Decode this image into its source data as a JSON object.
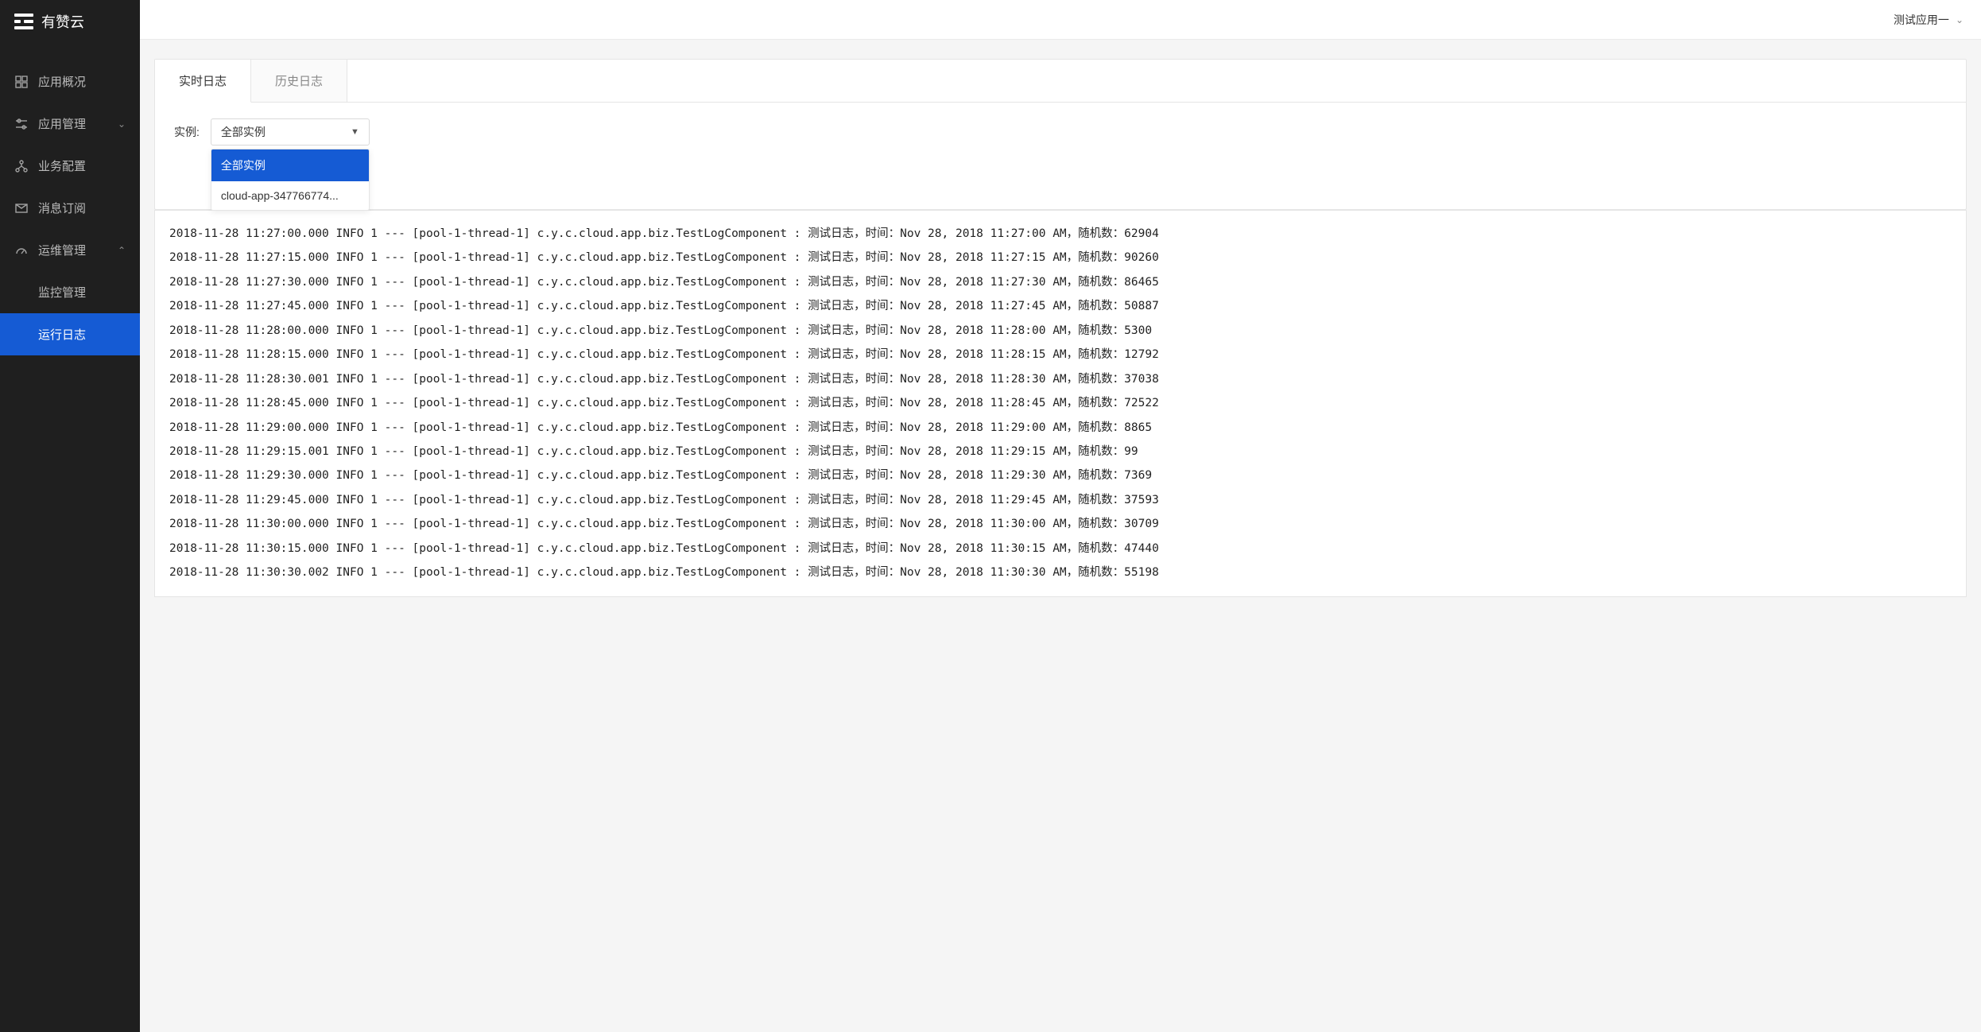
{
  "brand": "有赞云",
  "header": {
    "app_switcher_label": "测试应用一"
  },
  "sidebar": {
    "items": [
      {
        "label": "应用概况",
        "icon": "dashboard-icon"
      },
      {
        "label": "应用管理",
        "icon": "sliders-icon",
        "expandable": true,
        "expanded": false
      },
      {
        "label": "业务配置",
        "icon": "nodes-icon"
      },
      {
        "label": "消息订阅",
        "icon": "mail-icon"
      },
      {
        "label": "运维管理",
        "icon": "gauge-icon",
        "expandable": true,
        "expanded": true
      }
    ],
    "ops_sub": [
      {
        "label": "监控管理",
        "active": false
      },
      {
        "label": "运行日志",
        "active": true
      }
    ]
  },
  "tabs": [
    {
      "label": "实时日志",
      "active": true
    },
    {
      "label": "历史日志",
      "active": false
    }
  ],
  "filter": {
    "label": "实例:",
    "selected": "全部实例",
    "options": [
      "全部实例",
      "cloud-app-347766774..."
    ]
  },
  "logs": [
    "2018-11-28 11:27:00.000 INFO 1 --- [pool-1-thread-1] c.y.c.cloud.app.biz.TestLogComponent : 测试日志，时间：Nov 28, 2018 11:27:00 AM，随机数：62904",
    "2018-11-28 11:27:15.000 INFO 1 --- [pool-1-thread-1] c.y.c.cloud.app.biz.TestLogComponent : 测试日志，时间：Nov 28, 2018 11:27:15 AM，随机数：90260",
    "2018-11-28 11:27:30.000 INFO 1 --- [pool-1-thread-1] c.y.c.cloud.app.biz.TestLogComponent : 测试日志，时间：Nov 28, 2018 11:27:30 AM，随机数：86465",
    "2018-11-28 11:27:45.000 INFO 1 --- [pool-1-thread-1] c.y.c.cloud.app.biz.TestLogComponent : 测试日志，时间：Nov 28, 2018 11:27:45 AM，随机数：50887",
    "2018-11-28 11:28:00.000 INFO 1 --- [pool-1-thread-1] c.y.c.cloud.app.biz.TestLogComponent : 测试日志，时间：Nov 28, 2018 11:28:00 AM，随机数：5300",
    "2018-11-28 11:28:15.000 INFO 1 --- [pool-1-thread-1] c.y.c.cloud.app.biz.TestLogComponent : 测试日志，时间：Nov 28, 2018 11:28:15 AM，随机数：12792",
    "2018-11-28 11:28:30.001 INFO 1 --- [pool-1-thread-1] c.y.c.cloud.app.biz.TestLogComponent : 测试日志，时间：Nov 28, 2018 11:28:30 AM，随机数：37038",
    "2018-11-28 11:28:45.000 INFO 1 --- [pool-1-thread-1] c.y.c.cloud.app.biz.TestLogComponent : 测试日志，时间：Nov 28, 2018 11:28:45 AM，随机数：72522",
    "2018-11-28 11:29:00.000 INFO 1 --- [pool-1-thread-1] c.y.c.cloud.app.biz.TestLogComponent : 测试日志，时间：Nov 28, 2018 11:29:00 AM，随机数：8865",
    "2018-11-28 11:29:15.001 INFO 1 --- [pool-1-thread-1] c.y.c.cloud.app.biz.TestLogComponent : 测试日志，时间：Nov 28, 2018 11:29:15 AM，随机数：99",
    "2018-11-28 11:29:30.000 INFO 1 --- [pool-1-thread-1] c.y.c.cloud.app.biz.TestLogComponent : 测试日志，时间：Nov 28, 2018 11:29:30 AM，随机数：7369",
    "2018-11-28 11:29:45.000 INFO 1 --- [pool-1-thread-1] c.y.c.cloud.app.biz.TestLogComponent : 测试日志，时间：Nov 28, 2018 11:29:45 AM，随机数：37593",
    "2018-11-28 11:30:00.000 INFO 1 --- [pool-1-thread-1] c.y.c.cloud.app.biz.TestLogComponent : 测试日志，时间：Nov 28, 2018 11:30:00 AM，随机数：30709",
    "2018-11-28 11:30:15.000 INFO 1 --- [pool-1-thread-1] c.y.c.cloud.app.biz.TestLogComponent : 测试日志，时间：Nov 28, 2018 11:30:15 AM，随机数：47440",
    "2018-11-28 11:30:30.002 INFO 1 --- [pool-1-thread-1] c.y.c.cloud.app.biz.TestLogComponent : 测试日志，时间：Nov 28, 2018 11:30:30 AM，随机数：55198"
  ]
}
